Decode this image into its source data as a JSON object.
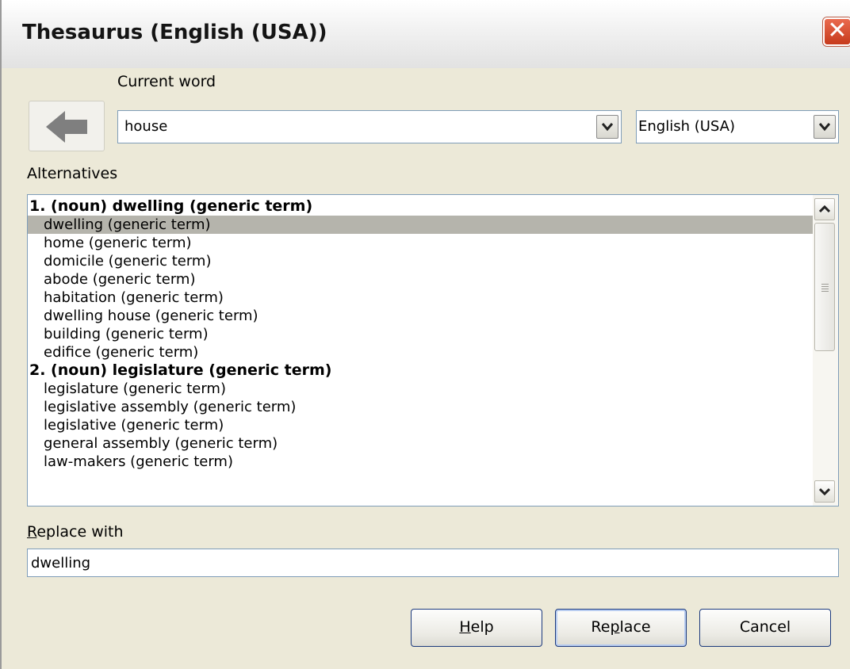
{
  "window": {
    "title": "Thesaurus (English (USA))",
    "close_glyph": "✕"
  },
  "current_word": {
    "label": "Current word",
    "value": "house"
  },
  "language": {
    "value": "English (USA)"
  },
  "alternatives": {
    "label": "Alternatives",
    "rows": [
      {
        "text": "1. (noun) dwelling (generic term)",
        "kind": "header"
      },
      {
        "text": "dwelling (generic term)",
        "kind": "item",
        "selected": true
      },
      {
        "text": "home (generic term)",
        "kind": "item"
      },
      {
        "text": "domicile (generic term)",
        "kind": "item"
      },
      {
        "text": "abode (generic term)",
        "kind": "item"
      },
      {
        "text": "habitation (generic term)",
        "kind": "item"
      },
      {
        "text": "dwelling house (generic term)",
        "kind": "item"
      },
      {
        "text": "building (generic term)",
        "kind": "item"
      },
      {
        "text": "edifice (generic term)",
        "kind": "item"
      },
      {
        "text": "2. (noun) legislature (generic term)",
        "kind": "header"
      },
      {
        "text": "legislature (generic term)",
        "kind": "item"
      },
      {
        "text": "legislative assembly (generic term)",
        "kind": "item"
      },
      {
        "text": "legislative (generic term)",
        "kind": "item"
      },
      {
        "text": "general assembly (generic term)",
        "kind": "item"
      },
      {
        "text": "law-makers (generic term)",
        "kind": "item"
      }
    ]
  },
  "replace_with": {
    "label_mnemonic": "R",
    "label_rest": "eplace with",
    "value": "dwelling"
  },
  "buttons": {
    "help": {
      "mnemonic": "H",
      "rest": "elp"
    },
    "replace": {
      "pre": "Re",
      "mnemonic": "p",
      "rest": "lace"
    },
    "cancel": {
      "label": "Cancel"
    }
  },
  "colors": {
    "selection": "#b5b4ac",
    "dialog_bg": "#ece9d8",
    "close_red": "#d44a2c"
  }
}
